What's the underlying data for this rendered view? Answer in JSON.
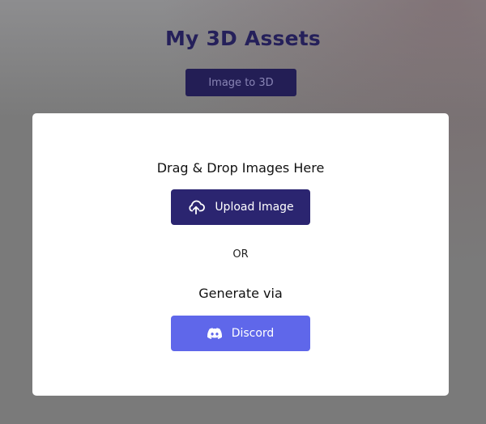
{
  "header": {
    "title": "My 3D Assets",
    "tab_label": "Image to 3D"
  },
  "upload_card": {
    "drop_text": "Drag & Drop Images Here",
    "upload_button_label": "Upload Image",
    "upload_icon": "cloud-upload-icon",
    "or_text": "OR",
    "generate_text": "Generate via",
    "discord_button_label": "Discord",
    "discord_icon": "discord-icon"
  },
  "colors": {
    "title": "#25205a",
    "primary_button": "#2b2570",
    "discord_button": "#5f67ea",
    "card_background": "#ffffff",
    "overlay": "#7a7a7a"
  }
}
